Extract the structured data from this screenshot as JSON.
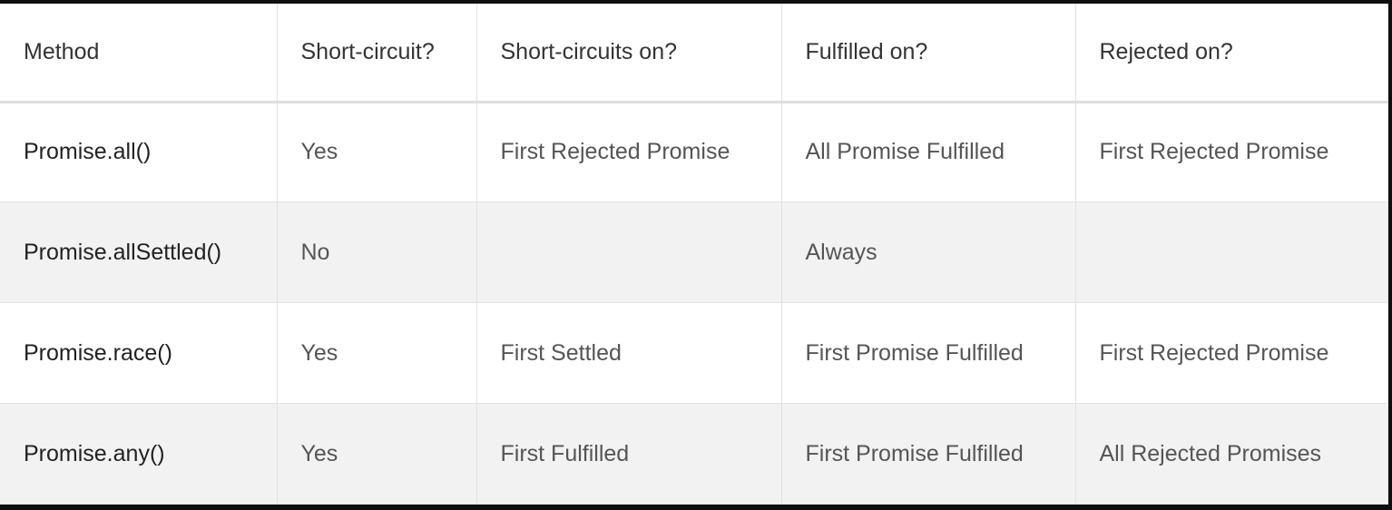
{
  "table": {
    "headers": [
      "Method",
      "Short-circuit?",
      "Short-circuits on?",
      "Fulfilled on?",
      "Rejected on?"
    ],
    "rows": [
      [
        "Promise.all()",
        "Yes",
        "First Rejected Promise",
        "All Promise Fulfilled",
        "First Rejected Promise"
      ],
      [
        "Promise.allSettled()",
        "No",
        "",
        "Always",
        ""
      ],
      [
        "Promise.race()",
        "Yes",
        "First Settled",
        "First Promise Fulfilled",
        "First Rejected Promise"
      ],
      [
        "Promise.any()",
        "Yes",
        "First Fulfilled",
        "First Promise Fulfilled",
        "All Rejected Promises"
      ]
    ]
  }
}
